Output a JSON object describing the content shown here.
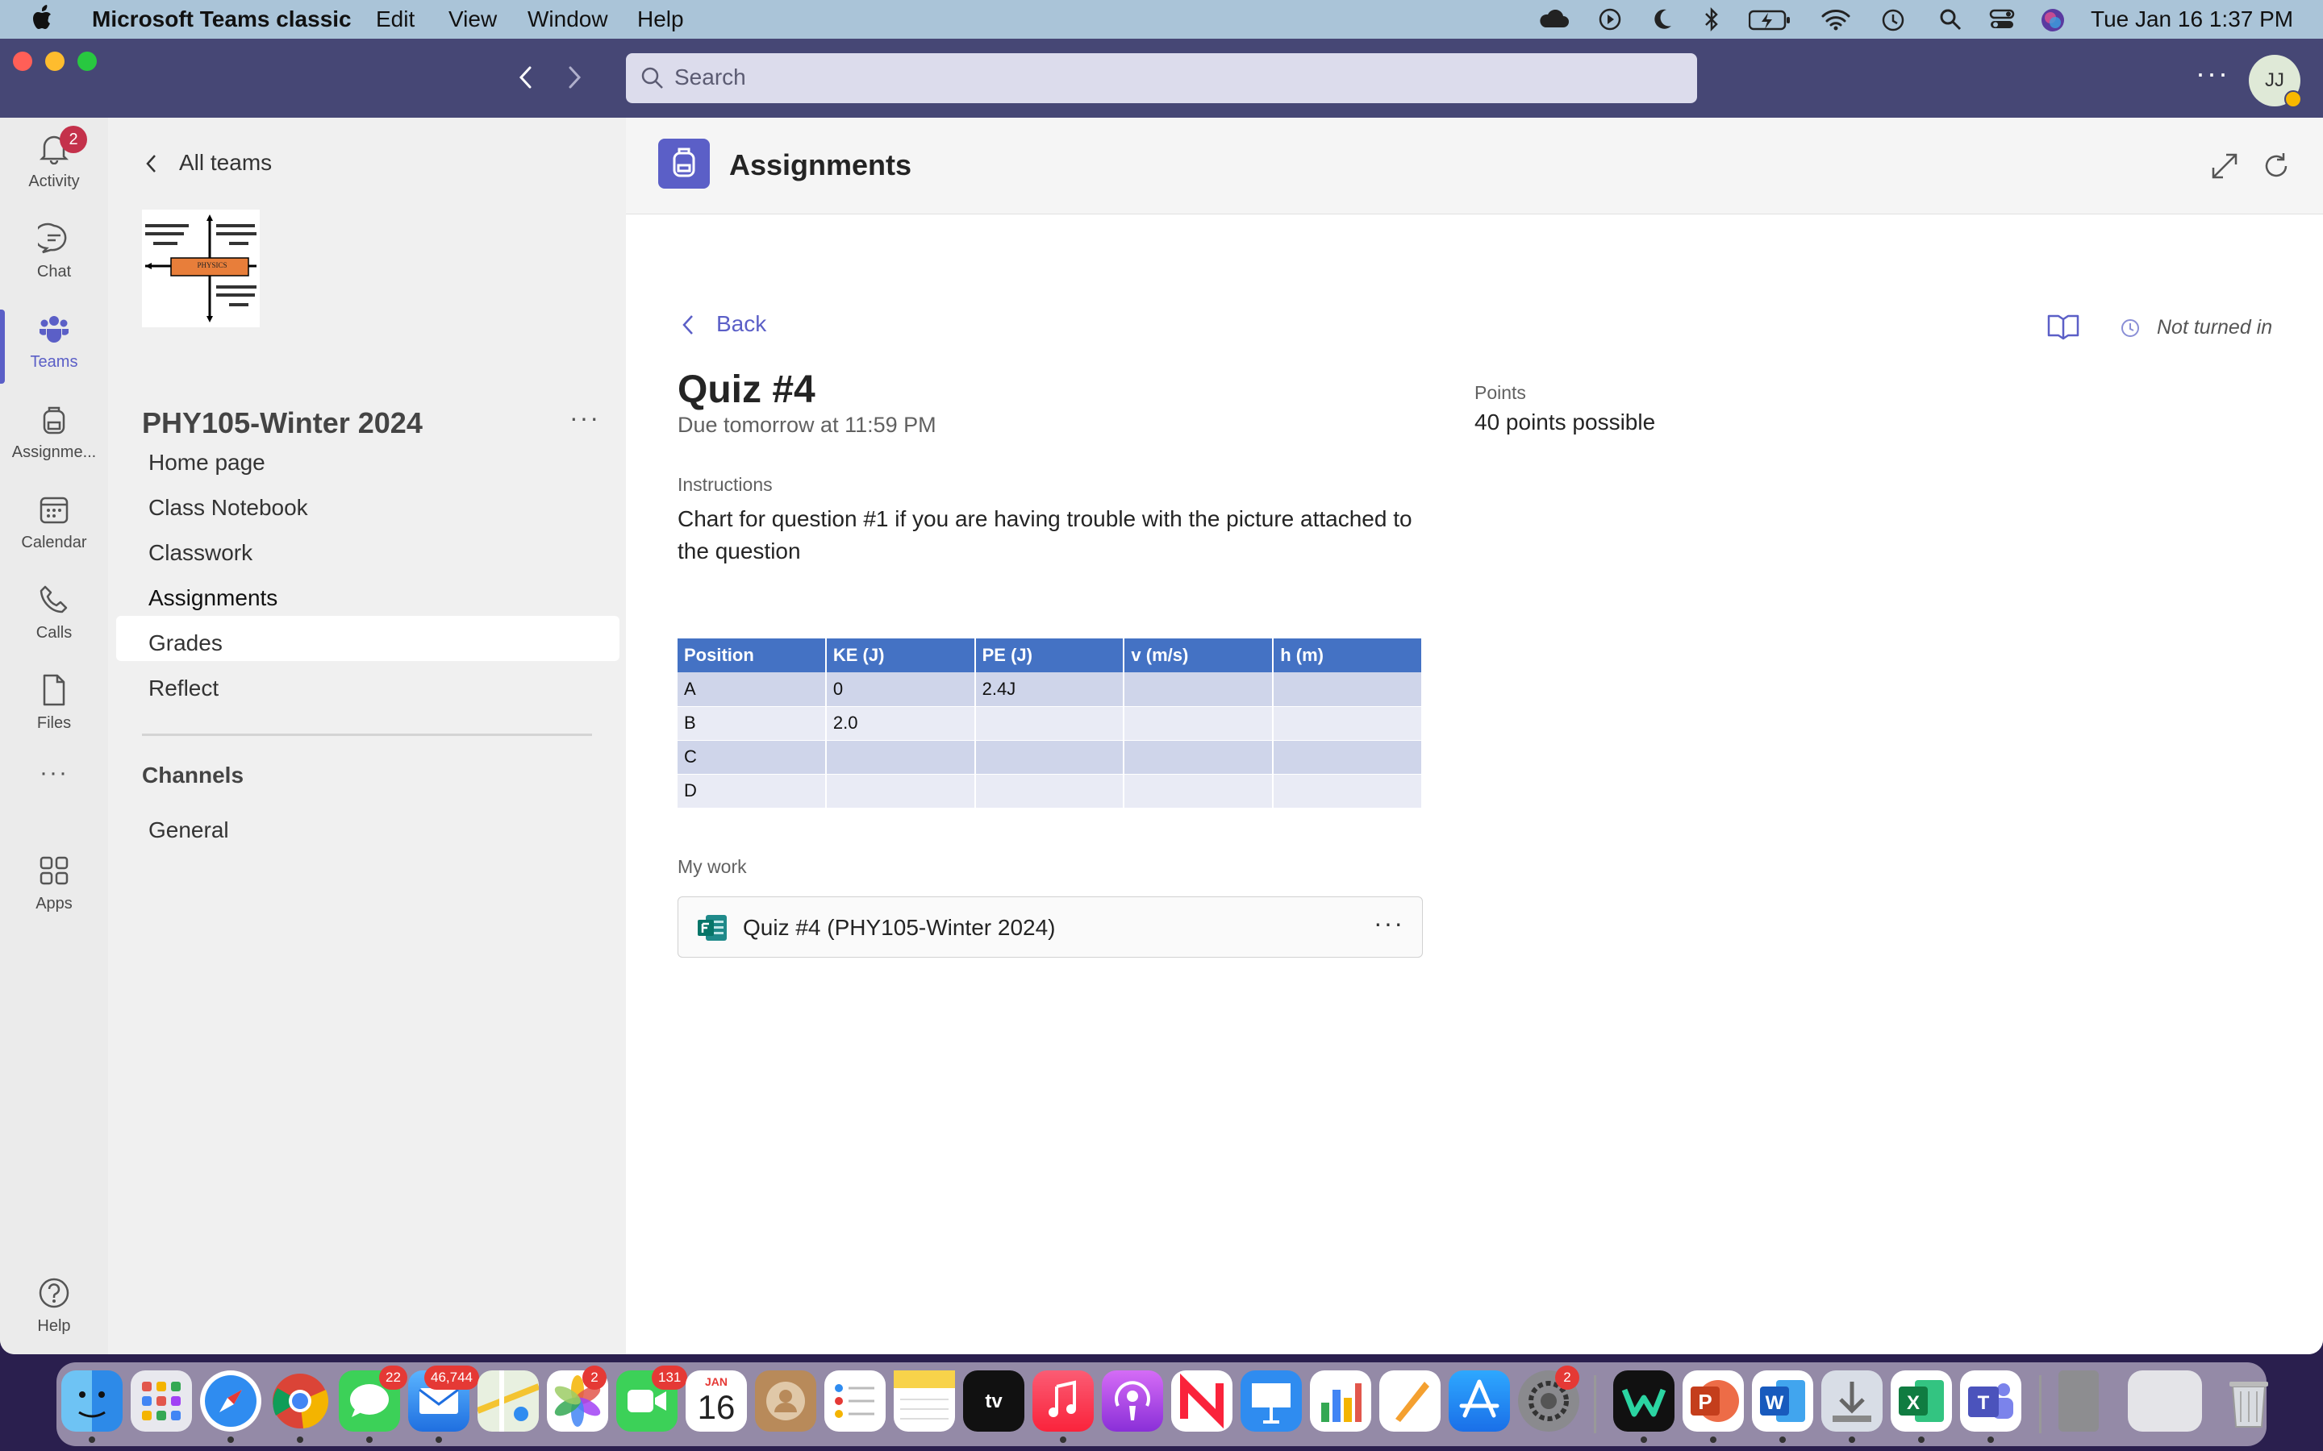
{
  "menubar": {
    "app_name": "Microsoft Teams classic",
    "menus": [
      "Edit",
      "View",
      "Window",
      "Help"
    ],
    "clock": "Tue Jan 16  1:37 PM"
  },
  "titlebar": {
    "search_placeholder": "Search",
    "avatar_initials": "JJ",
    "more": "···"
  },
  "rail": {
    "items": [
      {
        "label": "Activity",
        "badge": "2"
      },
      {
        "label": "Chat"
      },
      {
        "label": "Teams"
      },
      {
        "label": "Assignme..."
      },
      {
        "label": "Calendar"
      },
      {
        "label": "Calls"
      },
      {
        "label": "Files"
      },
      {
        "label": "···"
      },
      {
        "label": "Apps"
      },
      {
        "label": "Help"
      }
    ]
  },
  "team": {
    "back_label": "All teams",
    "name": "PHY105-Winter 2024",
    "logo_texts": [
      "PHYSICS"
    ],
    "nav": [
      "Home page",
      "Class Notebook",
      "Classwork",
      "Assignments",
      "Grades",
      "Reflect"
    ],
    "channels_heading": "Channels",
    "channels": [
      "General"
    ]
  },
  "app_header": {
    "title": "Assignments"
  },
  "assignment": {
    "back_label": "Back",
    "status": "Not turned in",
    "title": "Quiz #4",
    "due": "Due tomorrow at 11:59 PM",
    "points_label": "Points",
    "points_value": "40 points possible",
    "instructions_label": "Instructions",
    "instructions_text": "Chart for question #1 if you are having trouble with the picture attached to the question",
    "table": {
      "headers": [
        "Position",
        "KE (J)",
        " PE (J)",
        "v (m/s)",
        "h (m)"
      ],
      "rows": [
        [
          "A",
          "0",
          "2.4J",
          "",
          ""
        ],
        [
          "B",
          "2.0",
          "",
          "",
          ""
        ],
        [
          "C",
          "",
          "",
          "",
          ""
        ],
        [
          "D",
          "",
          "",
          "",
          ""
        ]
      ]
    },
    "my_work_label": "My work",
    "work_item": "Quiz #4 (PHY105-Winter 2024)",
    "work_more": "···"
  },
  "dock": {
    "badges": {
      "messages": "22",
      "mail": "46,744",
      "photos": "2",
      "facetime": "131",
      "settings": "2"
    },
    "calendar": {
      "month": "JAN",
      "day": "16"
    }
  }
}
